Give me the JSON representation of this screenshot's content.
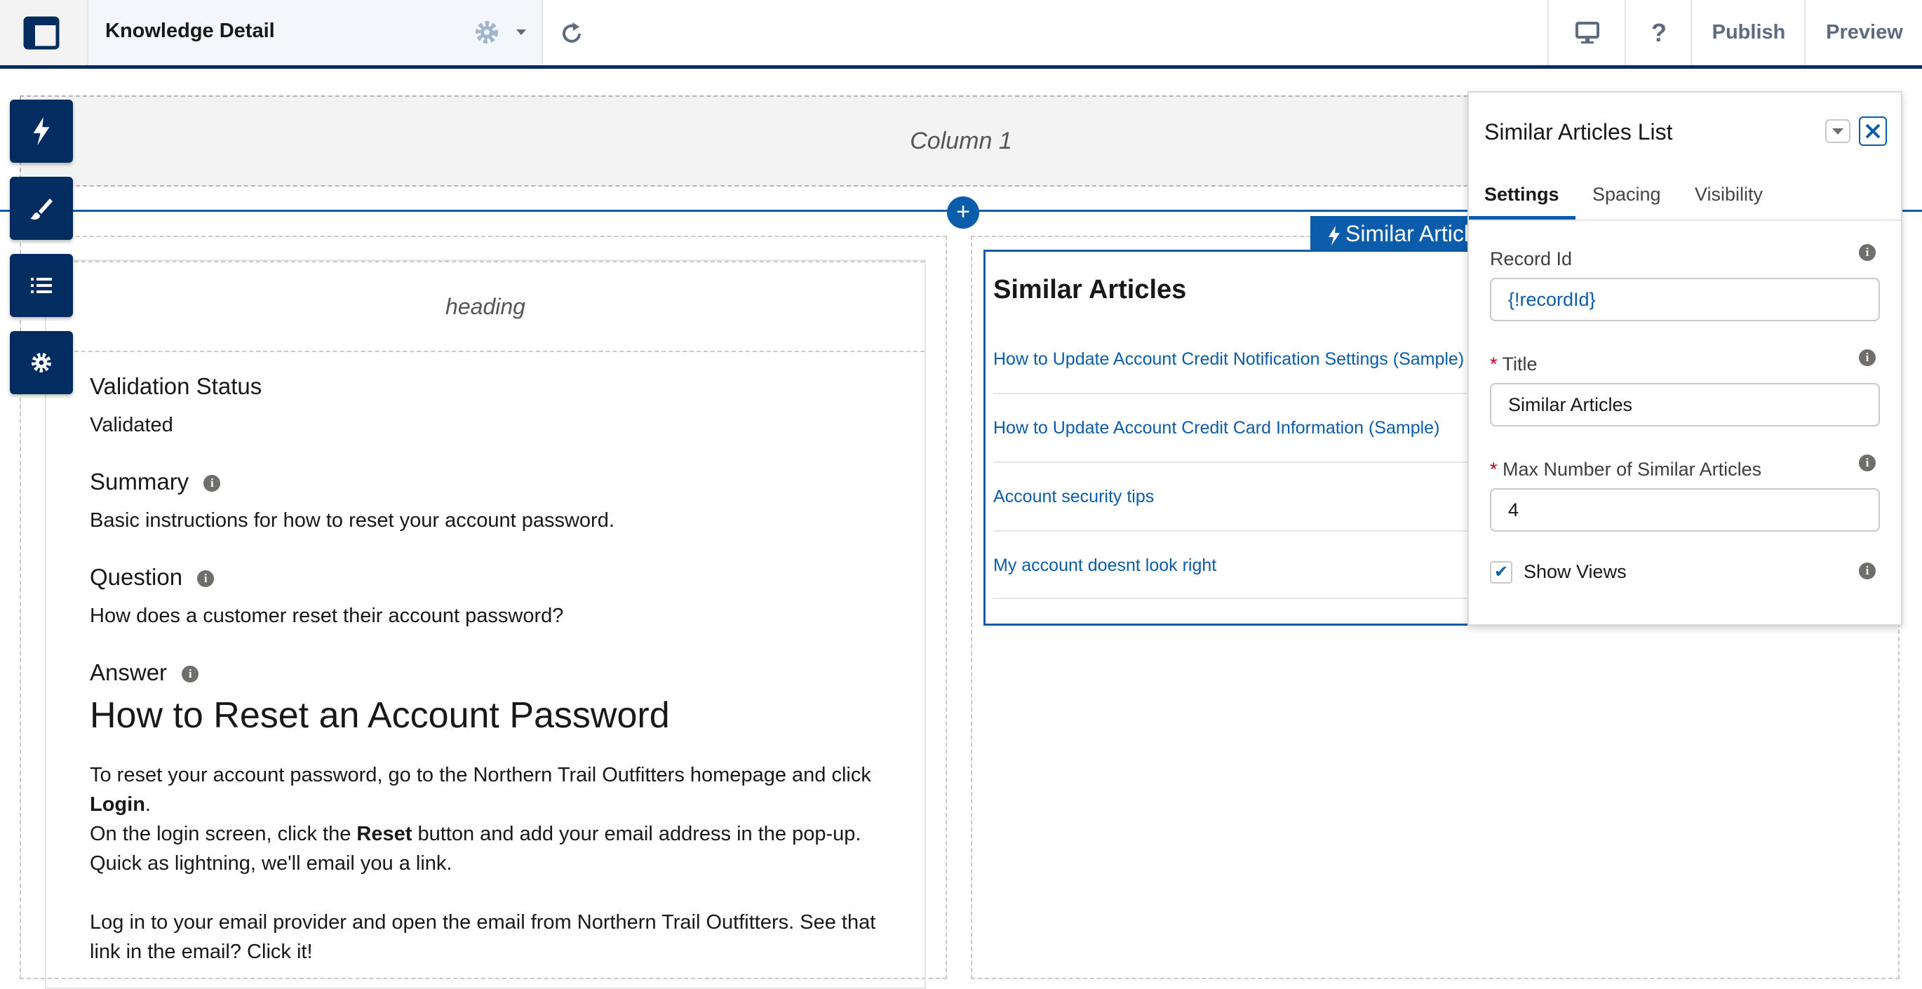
{
  "header": {
    "page_name": "Knowledge Detail",
    "publish_label": "Publish",
    "preview_label": "Preview"
  },
  "canvas": {
    "column_placeholder": "Column 1",
    "heading_placeholder": "heading",
    "validation_status_label": "Validation Status",
    "validation_status_value": "Validated",
    "summary_label": "Summary",
    "summary_value": "Basic instructions for how to reset your account password.",
    "question_label": "Question",
    "question_value": "How does a customer reset their account password?",
    "answer_label": "Answer",
    "answer_heading": "How to Reset an Account Password",
    "answer_p1a": "To reset your account password, go to the Northern Trail Outfitters homepage and click ",
    "answer_p1_login": "Login",
    "answer_p1b": ".",
    "answer_p2a": "On the login screen, click the ",
    "answer_p2_reset": "Reset",
    "answer_p2b": " button and add your email address in the pop-up. Quick as lightning, we'll email you a link.",
    "answer_p3": "Log in to your email provider and open the email from Northern Trail Outfitters. See that link in the email? Click it!"
  },
  "similar_articles": {
    "tag_label": "Similar Articles",
    "title": "Similar Articles",
    "links": [
      "How to Update Account Credit Notification Settings (Sample)",
      "How to Update Account Credit Card Information (Sample)",
      "Account security tips",
      "My account doesnt look right"
    ]
  },
  "panel": {
    "title": "Similar Articles List",
    "tabs": [
      "Settings",
      "Spacing",
      "Visibility"
    ],
    "record_id_label": "Record Id",
    "record_id_value": "{!recordId}",
    "title_label": "Title",
    "title_value": "Similar Articles",
    "max_label": "Max Number of Similar Articles",
    "max_value": "4",
    "show_views_label": "Show Views",
    "show_views_checked": true,
    "required_mark": "*"
  },
  "colors": {
    "brand_dark": "#032d60",
    "link_blue": "#0b5cab",
    "required_red": "#ba0517"
  }
}
